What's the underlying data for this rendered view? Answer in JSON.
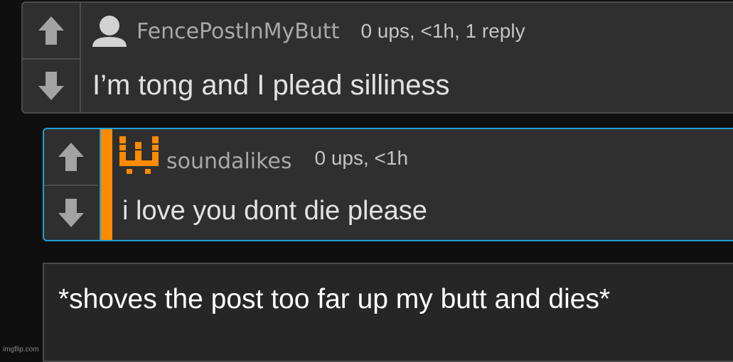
{
  "colors": {
    "page_bg": "#0f0f0f",
    "comment_bg": "#2f2f2f",
    "highlight_border": "#1ea0d6",
    "accent_bar": "#ff8a00",
    "username": "#a8a8a8",
    "body_text": "#e2e2e2"
  },
  "comments": [
    {
      "username": "FencePostInMyButt",
      "stats": "0 ups, <1h, 1 reply",
      "text": "I’m tong and I plead silliness",
      "avatar": "default-user-avatar-icon",
      "upvote_icon": "up-arrow-icon",
      "downvote_icon": "down-arrow-icon"
    },
    {
      "username": "soundalikes",
      "stats": "0 ups, <1h",
      "text": "i love you dont die please",
      "avatar": "pixel-w-avatar-icon",
      "upvote_icon": "up-arrow-icon",
      "downvote_icon": "down-arrow-icon",
      "highlighted": true
    }
  ],
  "reply_box": {
    "text": "*shoves the post too far up my butt and dies*"
  },
  "watermark": "imgflip.com"
}
